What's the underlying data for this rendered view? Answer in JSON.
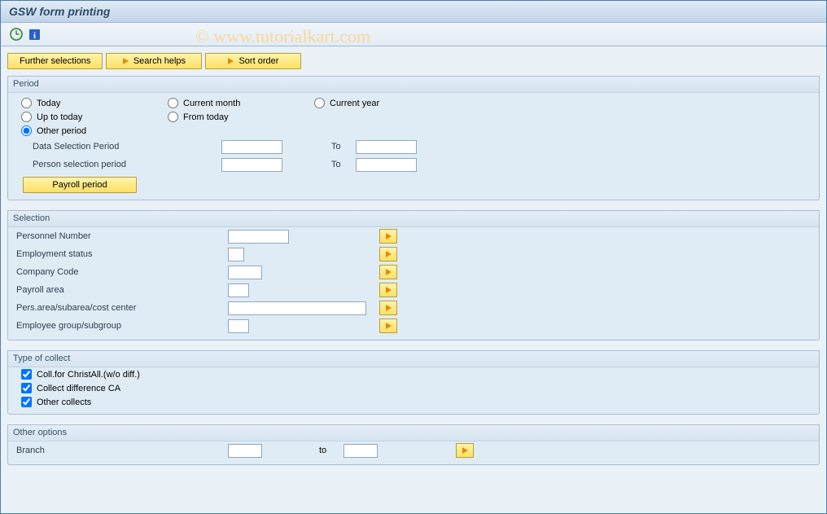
{
  "title": "GSW form printing",
  "watermark": "© www.tutorialkart.com",
  "buttons": {
    "further": "Further selections",
    "search": "Search helps",
    "sort": "Sort order",
    "payroll": "Payroll period"
  },
  "period": {
    "legend": "Period",
    "radios": {
      "today": "Today",
      "current_month": "Current month",
      "current_year": "Current year",
      "up_to_today": "Up to today",
      "from_today": "From today",
      "other_period": "Other period"
    },
    "data_sel": "Data Selection Period",
    "person_sel": "Person selection period",
    "to": "To"
  },
  "selection": {
    "legend": "Selection",
    "fields": {
      "pernr": "Personnel Number",
      "empstat": "Employment status",
      "company": "Company Code",
      "payarea": "Payroll area",
      "orgunit": "Pers.area/subarea/cost center",
      "empgroup": "Employee group/subgroup"
    }
  },
  "collect": {
    "legend": "Type of collect",
    "items": {
      "c1": "Coll.for ChristAll.(w/o diff.)",
      "c2": "Collect difference CA",
      "c3": "Other collects"
    }
  },
  "other": {
    "legend": "Other options",
    "branch": "Branch",
    "to": "to"
  }
}
